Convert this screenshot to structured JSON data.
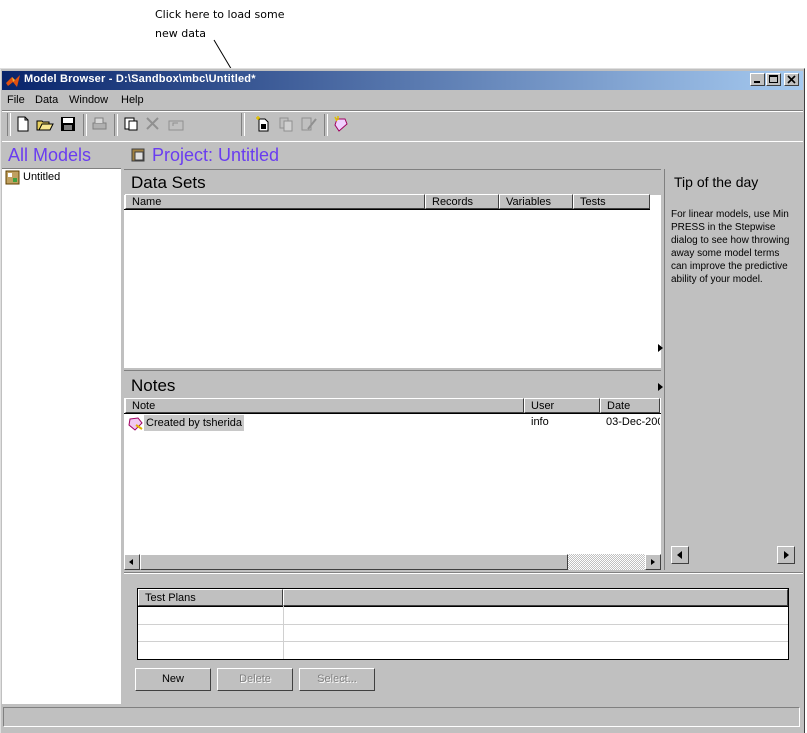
{
  "callout": {
    "line1": "Click here to load some",
    "line2": "new data"
  },
  "window": {
    "title": "Model Browser - D:\\Sandbox\\mbc\\Untitled*"
  },
  "menu": {
    "items": [
      "File",
      "Data",
      "Window",
      "Help"
    ]
  },
  "tree": {
    "header": "All Models",
    "items": [
      {
        "label": "Untitled"
      }
    ]
  },
  "project": {
    "title": "Project: Untitled"
  },
  "datasets": {
    "title": "Data Sets",
    "columns": [
      "Name",
      "Records",
      "Variables",
      "Tests"
    ]
  },
  "notes": {
    "title": "Notes",
    "columns": [
      "Note",
      "User",
      "Date"
    ],
    "rows": [
      {
        "note": "Created by tsherida",
        "user": "info",
        "date": "03-Dec-200"
      }
    ]
  },
  "tip": {
    "title": "Tip of the day",
    "text": "For linear models, use Min PRESS in the Stepwise dialog to see how throwing away some model terms can improve the predictive ability of your model."
  },
  "testplans": {
    "header": "Test Plans"
  },
  "buttons": {
    "new": "New",
    "delete": "Delete",
    "select": "Select..."
  },
  "colors": {
    "face": "#c0c0c0",
    "title_start": "#08246b",
    "title_end": "#a6caf0",
    "accent": "#6a3df0"
  }
}
